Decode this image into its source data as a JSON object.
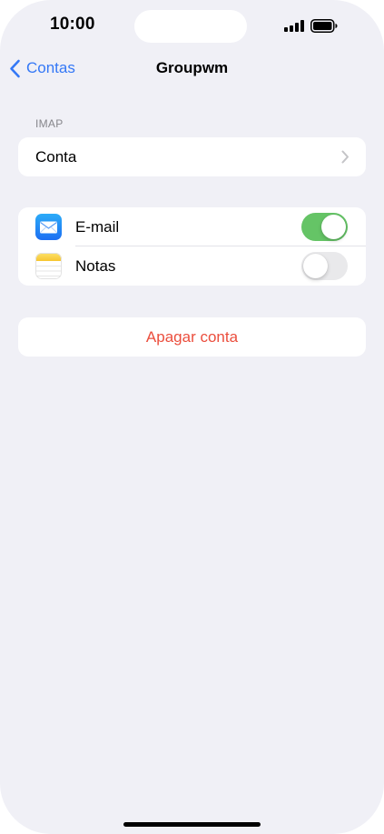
{
  "status_bar": {
    "time": "10:00"
  },
  "nav": {
    "back_label": "Contas",
    "title": "Groupwm"
  },
  "imap_section": {
    "header": "IMAP",
    "items": [
      {
        "label": "Conta"
      }
    ]
  },
  "apps_section": {
    "items": [
      {
        "label": "E-mail",
        "icon": "mail-icon",
        "enabled": true
      },
      {
        "label": "Notas",
        "icon": "notes-icon",
        "enabled": false
      }
    ]
  },
  "delete_section": {
    "label": "Apagar conta"
  },
  "colors": {
    "accent": "#3478f6",
    "toggle_on": "#65c466",
    "toggle_off": "#e9e9eb",
    "destructive": "#eb4e3d",
    "background": "#f0f0f6"
  }
}
